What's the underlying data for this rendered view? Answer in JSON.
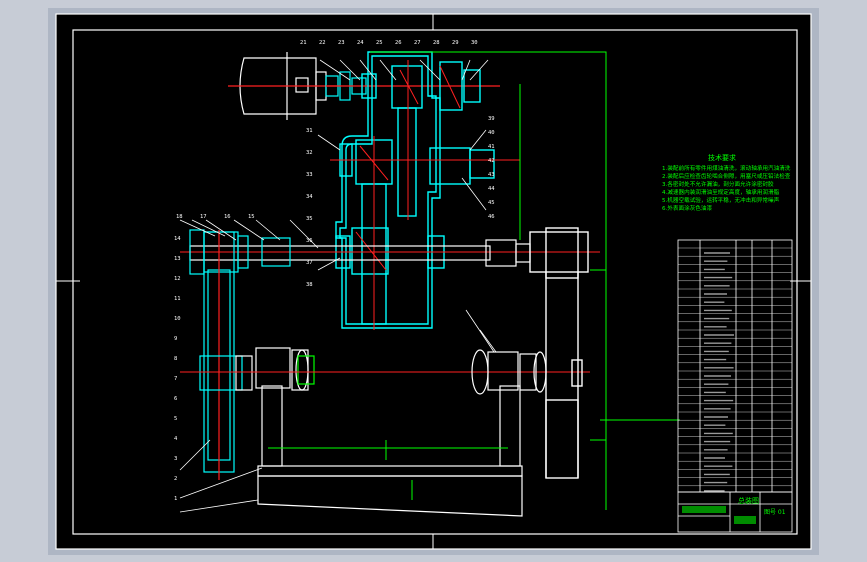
{
  "colors": {
    "window_bg": "#c7ccd6",
    "frame_bg": "#bfc6d2",
    "paper": "#000000",
    "border": "#ffffff",
    "cyan": "#00ffff",
    "green": "#00ff00",
    "red": "#ff2020",
    "white": "#ffffff"
  },
  "notes": {
    "title": "技术要求",
    "lines": [
      "1.装配前所有零件用煤油清洗，滚动轴承用汽油清洗",
      "2.装配后应检查齿轮啮合侧隙，用塞尺或压铅法检查",
      "3.各密封处不允许漏油，剖分面允许涂密封胶",
      "4.减速器内装润滑油至规定高度，轴承用润滑脂",
      "5.机器空载试验，运转平稳，无冲击和异常噪声",
      "6.外表面涂灰色油漆"
    ]
  },
  "title_block": {
    "label": "总装图",
    "drawing_no": "图号 01"
  },
  "balloons": {
    "top": [
      "21",
      "22",
      "23",
      "24",
      "25",
      "26",
      "27",
      "28",
      "29",
      "30"
    ],
    "left_upper": [
      "18",
      "17",
      "16",
      "15"
    ],
    "left_mid": [
      "14",
      "13",
      "12",
      "11",
      "10",
      "9",
      "8",
      "7",
      "6",
      "5",
      "4",
      "3",
      "2",
      "1"
    ],
    "center": [
      "31",
      "32",
      "33",
      "34",
      "35",
      "36",
      "37",
      "38"
    ],
    "right": [
      "39",
      "40",
      "41",
      "42",
      "43",
      "44",
      "45",
      "46"
    ]
  }
}
